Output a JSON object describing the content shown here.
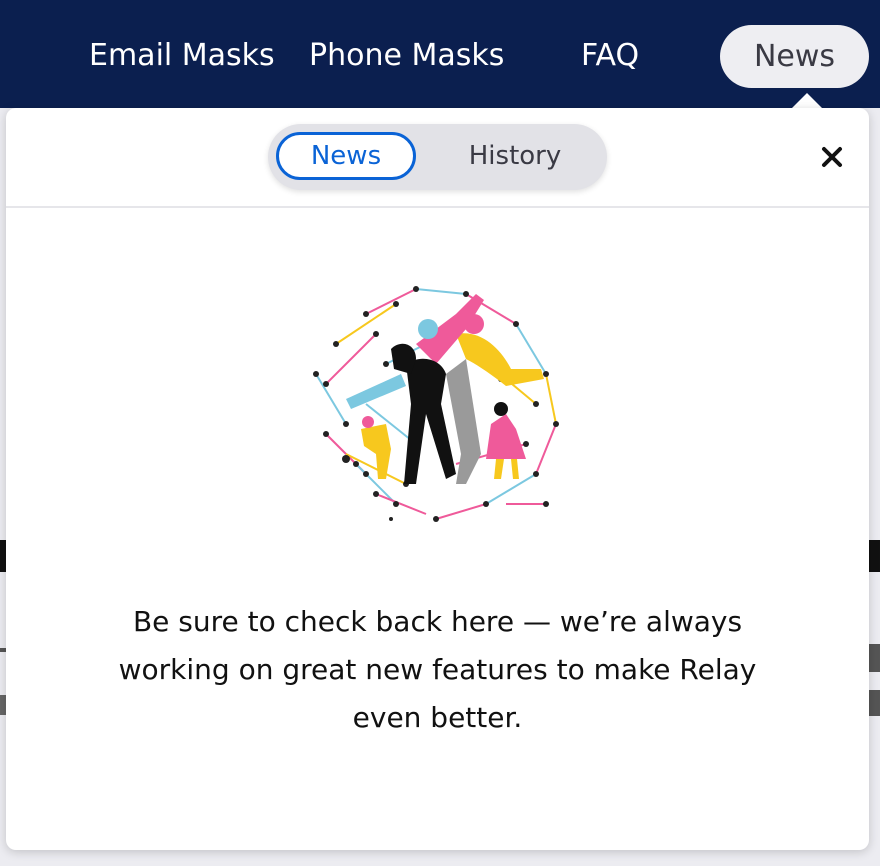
{
  "nav": {
    "links": [
      {
        "label": "Email Masks"
      },
      {
        "label": "Phone Masks"
      },
      {
        "label": "FAQ"
      },
      {
        "label": "News",
        "active": true
      }
    ]
  },
  "panel": {
    "tabs": [
      {
        "label": "News",
        "selected": true
      },
      {
        "label": "History",
        "selected": false
      }
    ],
    "close_icon": "close-icon",
    "illustration_icon": "people-network-illustration",
    "message": "Be sure to check back here — we’re always working on great new features to make Relay even better."
  },
  "colors": {
    "topbar": "#0b1f4f",
    "accent": "#0a63d6",
    "pill_bg": "#eeeef2",
    "illustration_yellow": "#f7c81e",
    "illustration_pink": "#ef5a9a",
    "illustration_blue": "#7cc8e0"
  }
}
